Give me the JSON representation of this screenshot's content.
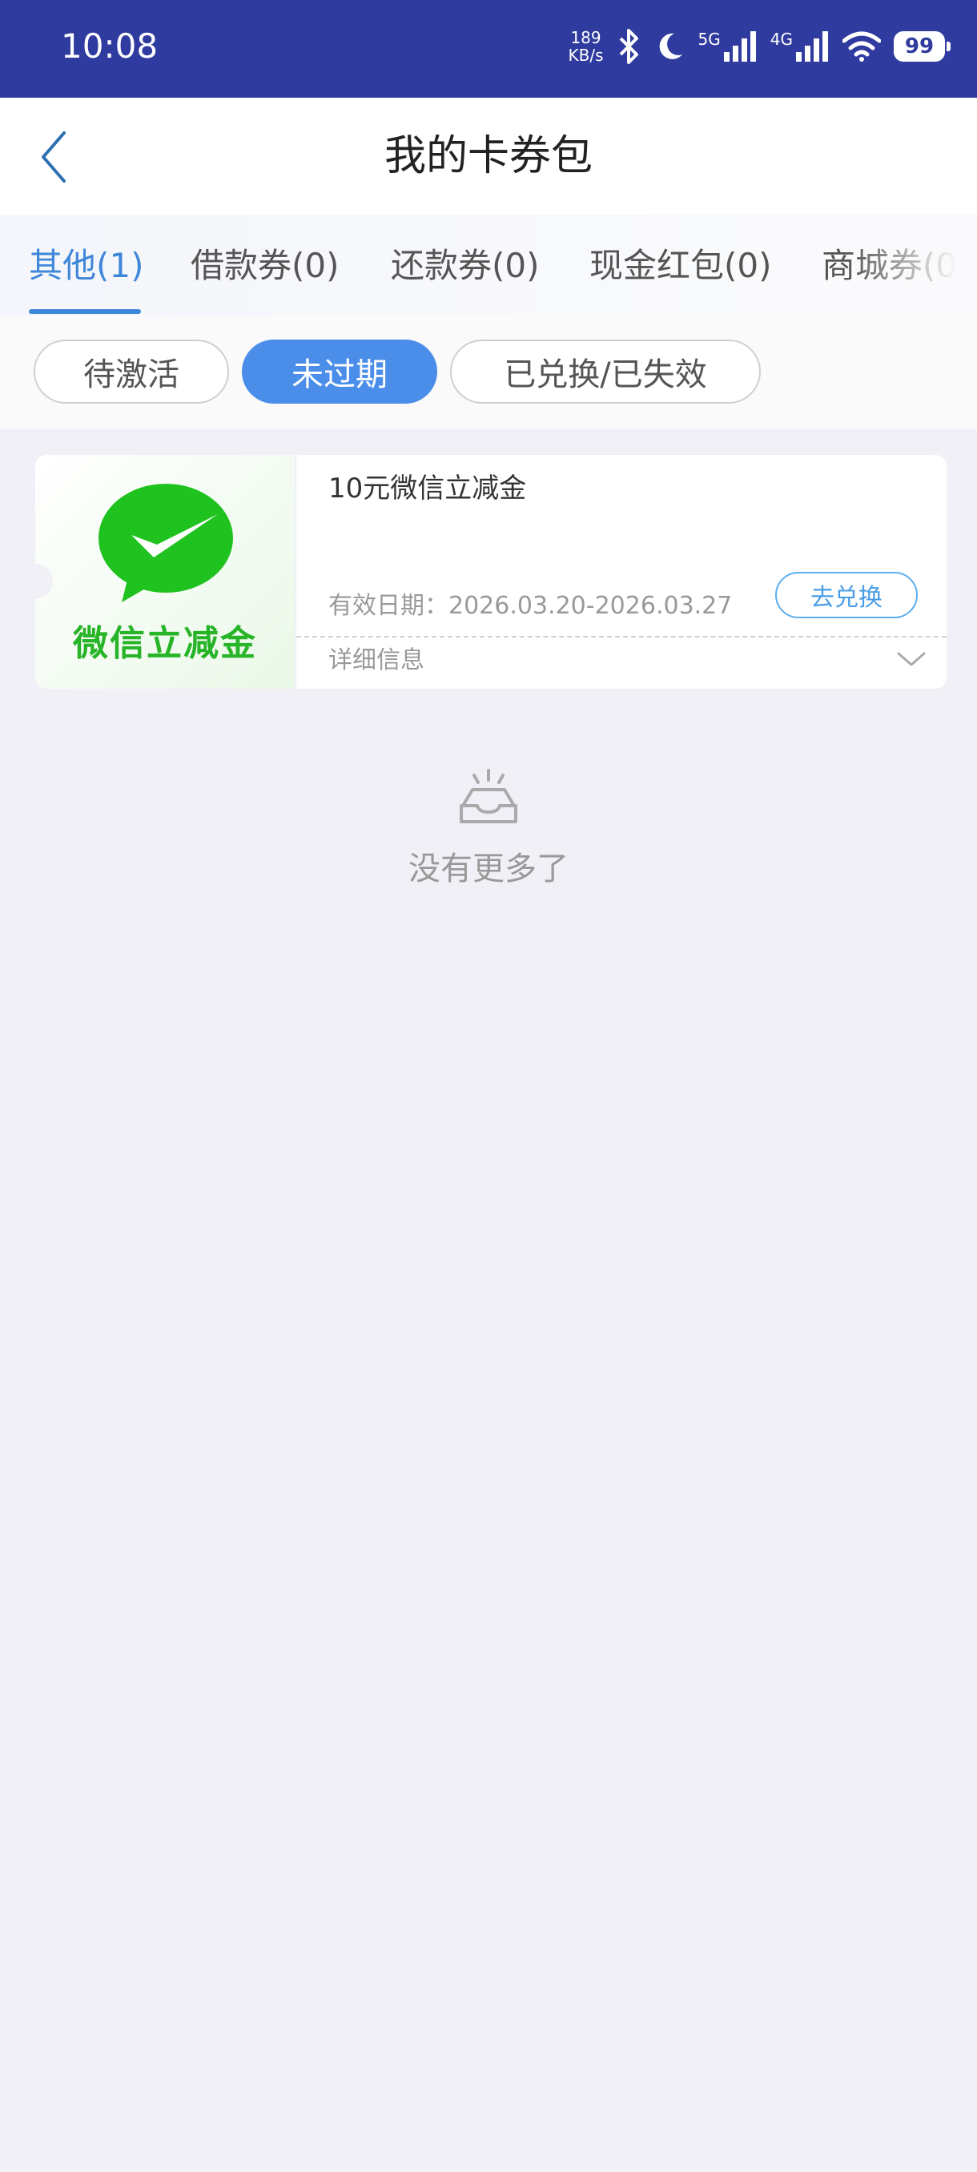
{
  "status_bar": {
    "time": "10:08",
    "net_speed_value": "189",
    "net_speed_unit": "KB/s",
    "sim1_label": "5G",
    "sim2_label": "4G",
    "battery": "99",
    "icons": [
      "bluetooth-icon",
      "moon-icon",
      "signal-icon",
      "signal-icon",
      "wifi-icon",
      "battery-icon"
    ]
  },
  "header": {
    "title": "我的卡券包",
    "back_icon": "chevron-left-icon"
  },
  "tabs": [
    {
      "label": "其他(1)",
      "active": true
    },
    {
      "label": "借款券(0)",
      "active": false
    },
    {
      "label": "还款券(0)",
      "active": false
    },
    {
      "label": "现金红包(0)",
      "active": false
    },
    {
      "label": "商城券(0",
      "active": false
    }
  ],
  "filters": [
    {
      "label": "待激活",
      "active": false
    },
    {
      "label": "未过期",
      "active": true
    },
    {
      "label": "已兑换/已失效",
      "active": false
    }
  ],
  "coupon": {
    "brand_text": "微信立减金",
    "title": "10元微信立减金",
    "validity": "有效日期：2026.03.20-2026.03.27",
    "action_label": "去兑换",
    "details_label": "详细信息"
  },
  "empty_state": {
    "text": "没有更多了"
  },
  "colors": {
    "status_bar": "#2f3b9e",
    "accent": "#4a8eea",
    "tab_active": "#3f87d9",
    "wechat_green": "#27b427",
    "background": "#f0f0f6"
  }
}
